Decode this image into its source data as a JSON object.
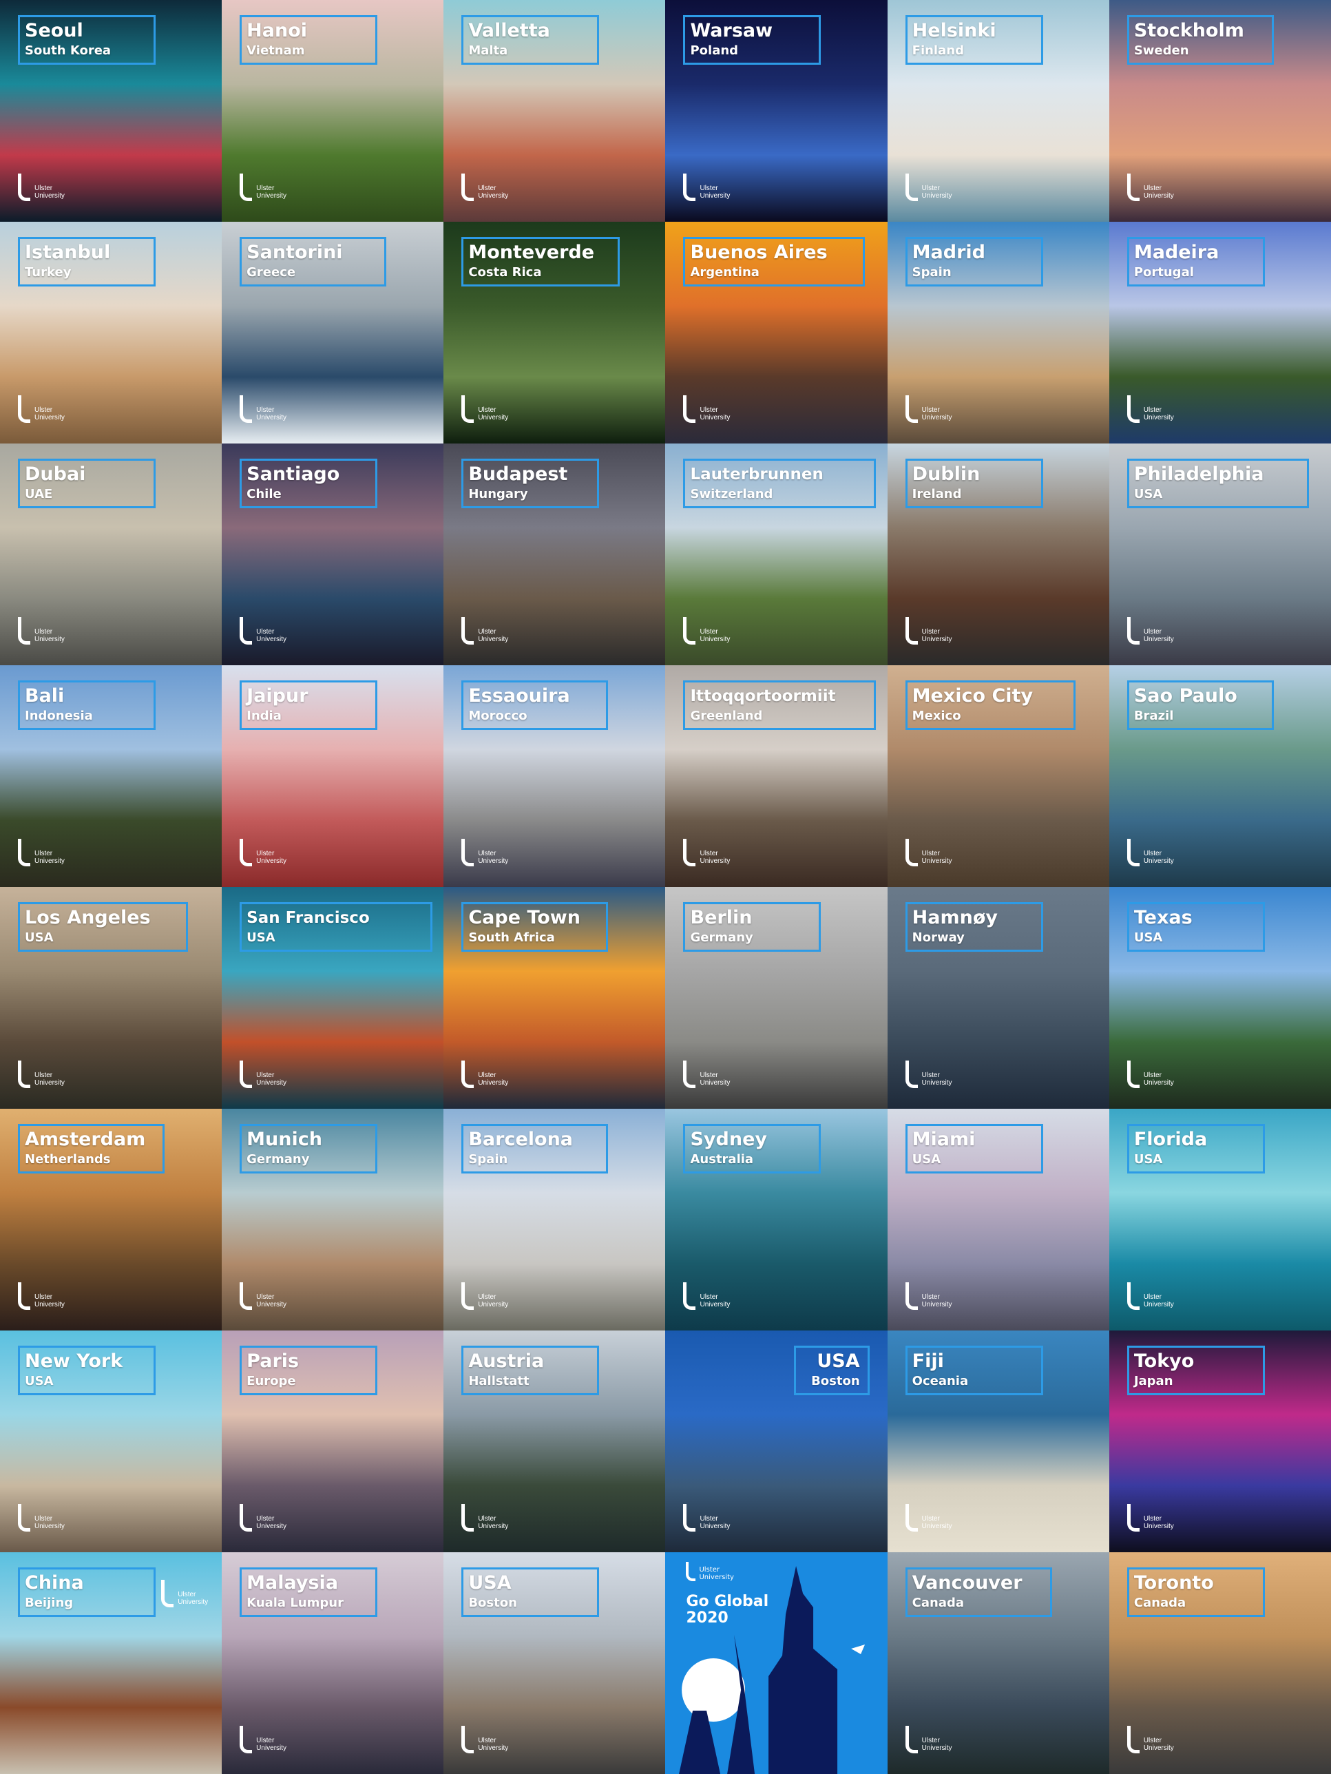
{
  "tiles": [
    {
      "city": "Seoul",
      "country": "South Korea",
      "bg": [
        "#0e2a3a",
        "#1a8a9a",
        "#c23a4a",
        "#0b1c2a"
      ]
    },
    {
      "city": "Hanoi",
      "country": "Vietnam",
      "bg": [
        "#e7c7c4",
        "#b9b6a0",
        "#4f7a2e",
        "#2e4a1a"
      ]
    },
    {
      "city": "Valletta",
      "country": "Malta",
      "bg": [
        "#8fcbd6",
        "#d3c8b8",
        "#c2664a",
        "#5b3a3a"
      ]
    },
    {
      "city": "Warsaw",
      "country": "Poland",
      "bg": [
        "#0c0f3a",
        "#1a2a6a",
        "#3a6ac6",
        "#0a0a1e"
      ]
    },
    {
      "city": "Helsinki",
      "country": "Finland",
      "bg": [
        "#9fc6d6",
        "#dde7ee",
        "#e9e1d6",
        "#5b8aa0"
      ]
    },
    {
      "city": "Stockholm",
      "country": "Sweden",
      "bg": [
        "#3d5a86",
        "#c88a8a",
        "#e1a07a",
        "#3a2a3a"
      ]
    },
    {
      "city": "Istanbul",
      "country": "Turkey",
      "bg": [
        "#b8d0dd",
        "#e6d8c8",
        "#c89a6a",
        "#7a5a3a"
      ]
    },
    {
      "city": "Santorini",
      "country": "Greece",
      "bg": [
        "#c9cfd4",
        "#9aa6ae",
        "#2a4a6a",
        "#e8eef2"
      ]
    },
    {
      "city": "Monteverde",
      "country": "Costa Rica",
      "bg": [
        "#1c3a1c",
        "#3a5a2a",
        "#6a8a4a",
        "#0e1e0e"
      ]
    },
    {
      "city": "Buenos Aires",
      "country": "Argentina",
      "bg": [
        "#f0a21a",
        "#e0702a",
        "#5a3a2a",
        "#2a2a3a"
      ]
    },
    {
      "city": "Madrid",
      "country": "Spain",
      "bg": [
        "#3a86c6",
        "#b8c6d0",
        "#c8a070",
        "#5a4a3a"
      ]
    },
    {
      "city": "Madeira",
      "country": "Portugal",
      "bg": [
        "#5a7ad0",
        "#b9c6e6",
        "#3a5a2a",
        "#1e3a6a"
      ]
    },
    {
      "city": "Dubai",
      "country": "UAE",
      "bg": [
        "#a8a8a0",
        "#c8c0ae",
        "#8a8a80",
        "#4a4a46"
      ]
    },
    {
      "city": "Santiago",
      "country": "Chile",
      "bg": [
        "#3a3a5a",
        "#8a6a7a",
        "#2a4a6a",
        "#1a1a2a"
      ]
    },
    {
      "city": "Budapest",
      "country": "Hungary",
      "bg": [
        "#4a4a56",
        "#7a7a86",
        "#6a5a4a",
        "#2a2a2a"
      ]
    },
    {
      "city": "Lauterbrunnen",
      "country": "Switzerland",
      "bg": [
        "#8ab0d0",
        "#c8d6e0",
        "#5a7a3a",
        "#3a4a2a"
      ]
    },
    {
      "city": "Dublin",
      "country": "Ireland",
      "bg": [
        "#c8d6e0",
        "#8a7a6a",
        "#5a3a2a",
        "#2a2a2a"
      ]
    },
    {
      "city": "Philadelphia",
      "country": "USA",
      "bg": [
        "#c8ccd0",
        "#9aa6b0",
        "#6a7a86",
        "#3a3a46"
      ]
    },
    {
      "city": "Bali",
      "country": "Indonesia",
      "bg": [
        "#6a9ad0",
        "#a0c0e0",
        "#3a4a2a",
        "#2a2a1e"
      ]
    },
    {
      "city": "Jaipur",
      "country": "India",
      "bg": [
        "#d8e0ee",
        "#e6b0b0",
        "#c25a5a",
        "#8a2a2a"
      ]
    },
    {
      "city": "Essaouira",
      "country": "Morocco",
      "bg": [
        "#7aa6d6",
        "#d0d6e0",
        "#8a8a8a",
        "#3a3a4a"
      ]
    },
    {
      "city": "Ittoqqortoormiit",
      "country": "Greenland",
      "bg": [
        "#b0aaa6",
        "#d6cfc8",
        "#6a5a4a",
        "#3a2a22"
      ]
    },
    {
      "city": "Mexico City",
      "country": "Mexico",
      "bg": [
        "#d0b090",
        "#b08a6a",
        "#6a5a4a",
        "#4a3a2a"
      ]
    },
    {
      "city": "Sao Paulo",
      "country": "Brazil",
      "bg": [
        "#b6d0e6",
        "#6a9a8a",
        "#3a6a8a",
        "#1e3a4a"
      ]
    },
    {
      "city": "Los Angeles",
      "country": "USA",
      "bg": [
        "#c6b29a",
        "#9a8a72",
        "#5a4a3a",
        "#2a2a22"
      ]
    },
    {
      "city": "San Francisco",
      "country": "USA",
      "bg": [
        "#1a6a86",
        "#3aa6c0",
        "#c2502a",
        "#0e3a4a"
      ]
    },
    {
      "city": "Cape Town",
      "country": "South Africa",
      "bg": [
        "#2a5a86",
        "#f0a030",
        "#c25a2a",
        "#1e2a3a"
      ]
    },
    {
      "city": "Berlin",
      "country": "Germany",
      "bg": [
        "#c6c6c6",
        "#a6a6a6",
        "#8a8a86",
        "#3a3a3a"
      ]
    },
    {
      "city": "Hamnøy",
      "country": "Norway",
      "bg": [
        "#6a7a8a",
        "#5a6a7a",
        "#3a4a5a",
        "#1e2a3a"
      ]
    },
    {
      "city": "Texas",
      "country": "USA",
      "bg": [
        "#3a86d0",
        "#8ab8e6",
        "#3a6a3a",
        "#1e2a1e"
      ]
    },
    {
      "city": "Amsterdam",
      "country": "Netherlands",
      "bg": [
        "#e0b070",
        "#c08040",
        "#6a4a2a",
        "#2a1e1a"
      ]
    },
    {
      "city": "Munich",
      "country": "Germany",
      "bg": [
        "#4a86a0",
        "#b8ccd0",
        "#b08a6a",
        "#5a4a3a"
      ]
    },
    {
      "city": "Barcelona",
      "country": "Spain",
      "bg": [
        "#8ab0d6",
        "#d6dde6",
        "#c8c6c2",
        "#6a6a60"
      ]
    },
    {
      "city": "Sydney",
      "country": "Australia",
      "bg": [
        "#9ac6e0",
        "#3a8aa0",
        "#1a5a6a",
        "#0e3a4a"
      ]
    },
    {
      "city": "Miami",
      "country": "USA",
      "bg": [
        "#d6dce6",
        "#c0b0c6",
        "#8a8aa6",
        "#4a4a5a"
      ]
    },
    {
      "city": "Florida",
      "country": "USA",
      "bg": [
        "#3aa6c6",
        "#8ad6e0",
        "#1a8aa6",
        "#0e5a6a"
      ]
    },
    {
      "city": "New York",
      "country": "USA",
      "bg": [
        "#5ac0e0",
        "#9ad6e6",
        "#c8b8a0",
        "#6a5a4a"
      ]
    },
    {
      "city": "Paris",
      "country": "Europe",
      "bg": [
        "#b8a0b8",
        "#e0c0b0",
        "#6a5a6a",
        "#2a2a3a"
      ]
    },
    {
      "city": "Austria",
      "country": "Hallstatt",
      "bg": [
        "#c8d0d8",
        "#8a9aa6",
        "#3a4a3a",
        "#1e2a2a"
      ]
    },
    {
      "city": "USA",
      "country": "Boston",
      "bg": [
        "#1a5ab0",
        "#2a6ac6",
        "#3a5a7a",
        "#1e2a3a"
      ]
    },
    {
      "city": "Fiji",
      "country": "Oceania",
      "bg": [
        "#3a86c0",
        "#2a6a9a",
        "#d6d0c0",
        "#e6e0d0"
      ]
    },
    {
      "city": "Tokyo",
      "country": "Japan",
      "bg": [
        "#1e1a3a",
        "#c02a8a",
        "#3a3aa0",
        "#0e0e1e"
      ]
    },
    {
      "city": "China",
      "country": "Beijing",
      "bg": [
        "#5ac0e0",
        "#a0d6e6",
        "#8a4a2a",
        "#c8c0b0"
      ]
    },
    {
      "city": "Malaysia",
      "country": "Kuala Lumpur",
      "bg": [
        "#d6ccd6",
        "#b8a6b8",
        "#6a5a6a",
        "#2a2a3a"
      ]
    },
    {
      "city": "USA",
      "country": "Boston",
      "bg": [
        "#d6dde6",
        "#b0b8c0",
        "#8a7a6a",
        "#3a3a3a"
      ]
    },
    {
      "city": "",
      "country": "",
      "bg": [
        "#1a8ae0",
        "#1a8ae0",
        "#1a8ae0",
        "#1a8ae0"
      ]
    },
    {
      "city": "Vancouver",
      "country": "Canada",
      "bg": [
        "#9aa6b0",
        "#6a7a86",
        "#3a4a5a",
        "#1e2a2a"
      ]
    },
    {
      "city": "Toronto",
      "country": "Canada",
      "bg": [
        "#e0b07a",
        "#c0905a",
        "#6a5a4a",
        "#3a3a3a"
      ]
    }
  ],
  "logo_text_line1": "Ulster",
  "logo_text_line2": "University",
  "go_global_line1": "Go Global",
  "go_global_line2": "2020",
  "accent": "#2d9be6"
}
